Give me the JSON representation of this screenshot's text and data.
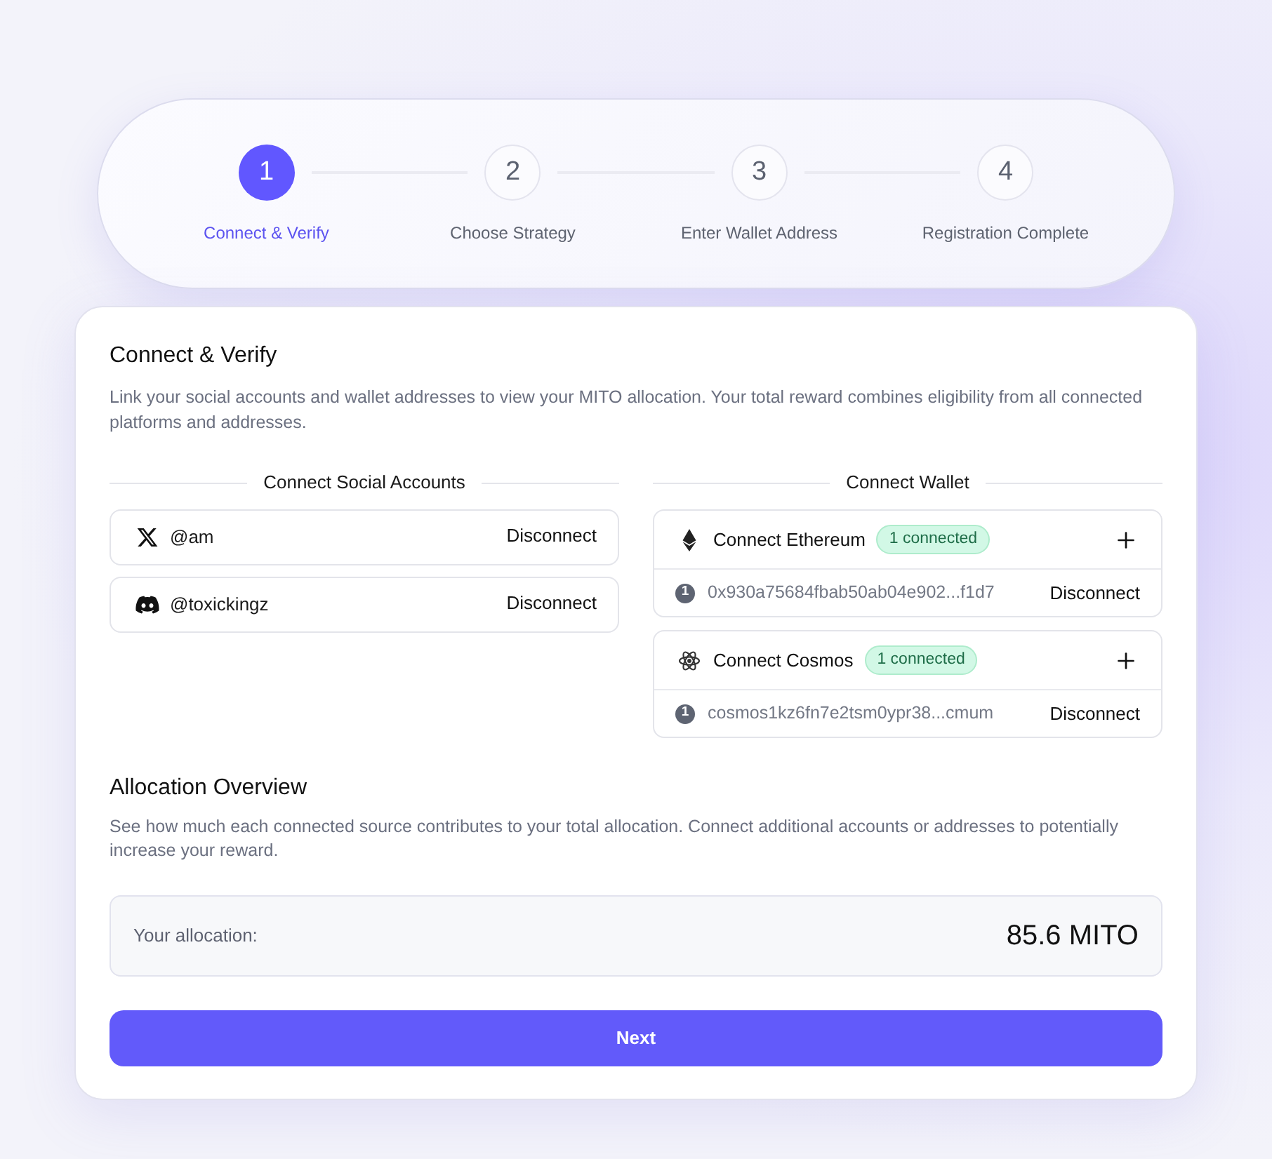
{
  "stepper": {
    "steps": [
      {
        "number": "1",
        "label": "Connect & Verify",
        "selected": true
      },
      {
        "number": "2",
        "label": "Choose Strategy",
        "selected": false
      },
      {
        "number": "3",
        "label": "Enter Wallet Address",
        "selected": false
      },
      {
        "number": "4",
        "label": "Registration Complete",
        "selected": false
      }
    ]
  },
  "card": {
    "title": "Connect & Verify",
    "description": "Link your social accounts and wallet addresses to view your MITO allocation. Your total reward combines eligibility from all connected platforms and addresses.",
    "social": {
      "heading": "Connect Social Accounts",
      "accounts": [
        {
          "kind": "x",
          "handle": "@am",
          "action": "Disconnect"
        },
        {
          "kind": "discord",
          "handle": "@toxickingz",
          "action": "Disconnect"
        }
      ]
    },
    "wallet": {
      "heading": "Connect Wallet",
      "chains": [
        {
          "kind": "ethereum",
          "label": "Connect Ethereum",
          "badge": "1 connected",
          "addresses": [
            {
              "index": "1",
              "address": "0x930a75684fbab50ab04e902...f1d7",
              "action": "Disconnect"
            }
          ]
        },
        {
          "kind": "cosmos",
          "label": "Connect Cosmos",
          "badge": "1 connected",
          "addresses": [
            {
              "index": "1",
              "address": "cosmos1kz6fn7e2tsm0ypr38...cmum",
              "action": "Disconnect"
            }
          ]
        }
      ]
    },
    "allocation": {
      "title": "Allocation Overview",
      "description": "See how much each connected source contributes to your total allocation. Connect additional accounts or addresses to potentially increase your reward.",
      "label": "Your allocation:",
      "value": "85.6 MITO"
    },
    "next_button": "Next"
  }
}
